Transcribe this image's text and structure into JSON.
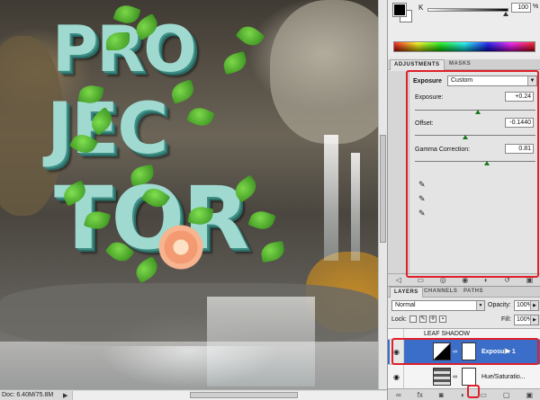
{
  "artwork": {
    "letters_row1": "PRO",
    "letters_row2": "JEC",
    "letters_row3": "TOR"
  },
  "status": {
    "doc_size": "Doc: 6.40M/75.8M",
    "arrow": "▶"
  },
  "color_panel": {
    "channel_label": "K",
    "channel_value": "100",
    "channel_unit": "%"
  },
  "adjustments": {
    "tabs": [
      "ADJUSTMENTS",
      "MASKS"
    ],
    "type_label": "Exposure",
    "preset": "Custom",
    "params": [
      {
        "label": "Exposure:",
        "value": "+0.24",
        "position": 0.52
      },
      {
        "label": "Offset:",
        "value": "-0.1440",
        "position": 0.42
      },
      {
        "label": "Gamma Correction:",
        "value": "0.81",
        "position": 0.6
      }
    ]
  },
  "layers": {
    "tabs": [
      "LAYERS",
      "CHANNELS",
      "PATHS"
    ],
    "blend_mode": "Normal",
    "opacity_label": "Opacity:",
    "opacity_value": "100%",
    "lock_label": "Lock:",
    "fill_label": "Fill:",
    "fill_value": "100%",
    "rows": [
      {
        "name": "LEAF SHADOW"
      },
      {
        "name": "Exposure 1"
      },
      {
        "name": "Hue/Saturatio..."
      }
    ]
  },
  "colors": {
    "annotation": "#e0202a",
    "selected_layer": "#3a6ec9",
    "letter_face": "#9fd9cf"
  }
}
